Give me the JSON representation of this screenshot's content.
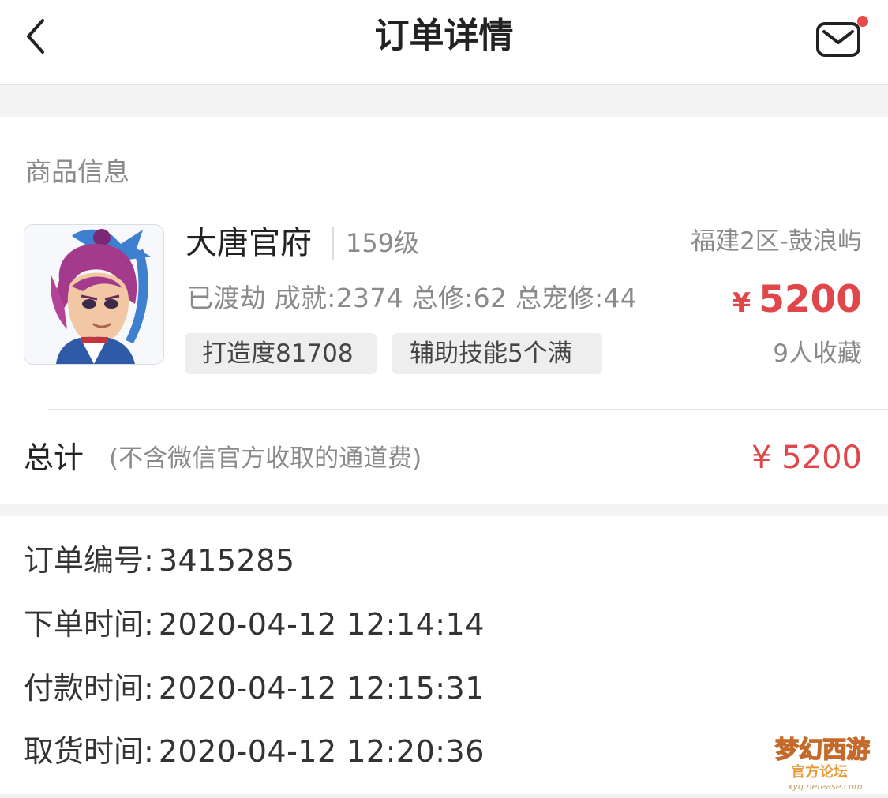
{
  "header": {
    "title": "订单详情"
  },
  "goods": {
    "section_label": "商品信息",
    "name": "大唐官府",
    "level": "159级",
    "server": "福建2区-鼓浪屿",
    "stats": "已渡劫 成就:2374 总修:62 总宠修:44",
    "price_symbol": "¥",
    "price": "5200",
    "tags": [
      "打造度81708",
      "辅助技能5个满"
    ],
    "favorites": "9人收藏"
  },
  "total": {
    "label": "总计",
    "note": "(不含微信官方收取的通道费)",
    "price": "¥ 5200"
  },
  "order_info": [
    {
      "label": "订单编号:",
      "value": "3415285"
    },
    {
      "label": "下单时间:",
      "value": "2020-04-12 12:14:14"
    },
    {
      "label": "付款时间:",
      "value": "2020-04-12 12:15:31"
    },
    {
      "label": "取货时间:",
      "value": "2020-04-12 12:20:36"
    }
  ],
  "watermark": {
    "title": "梦幻西游",
    "subtitle": "官方论坛",
    "url": "xyq.netease.com"
  },
  "colors": {
    "price_red": "#e0474b",
    "notification_dot": "#e84a4a",
    "muted_text": "#8a8a8a",
    "tag_background": "#eeeeee"
  },
  "icons": {
    "back": "chevron-left-icon",
    "mail": "mail-icon",
    "notification": "notification-dot-icon"
  }
}
